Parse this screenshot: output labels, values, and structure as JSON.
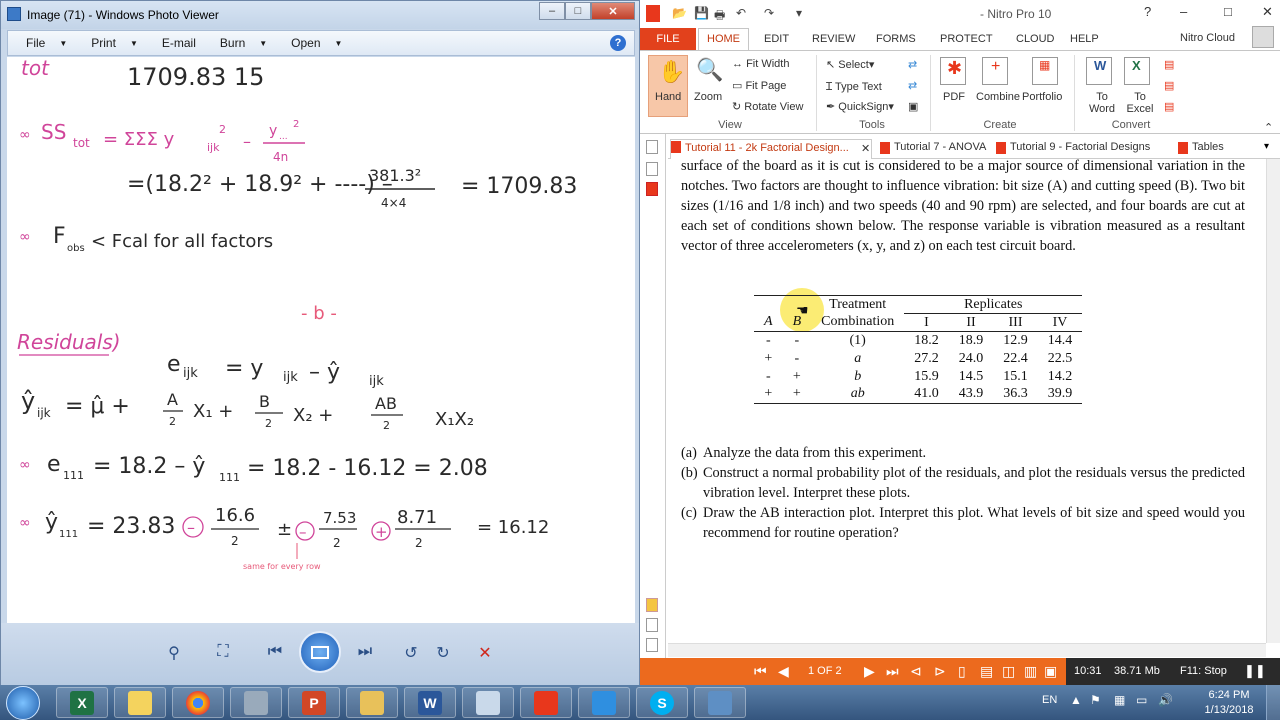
{
  "photo_viewer": {
    "title": "Image (71) - Windows Photo Viewer",
    "menu": [
      "File",
      "Print",
      "E-mail",
      "Burn",
      "Open"
    ],
    "help_label": "?",
    "notes": {
      "top_label": "tot",
      "line0": "1709.83    15",
      "line1_left": "SS",
      "line1_sub": "tot",
      "line1_expr": "= ΣΣΣ y",
      "line1_sub2": "ijk",
      "line1_exp": "2",
      "line1_minus": "–",
      "line1_frac_num": "y",
      "line1_frac_sub": "...",
      "line1_frac_exp": "2",
      "line1_frac_den": "4n",
      "line2": "=(18.2² + 18.9² + ----) –",
      "line2_frac_num": "381.3²",
      "line2_frac_den": "4×4",
      "line2_result": "=   1709.83",
      "line3": "F",
      "line3_sub": "obs",
      "line3_rest": "< Fcal    for all factors",
      "marker": "- b -",
      "residuals": "Residuals)",
      "eq1": "e",
      "eq1_sub": "ijk",
      "eq1_rest": "=  y",
      "eq1_sub2": "ijk",
      "eq1_rest2": "–  ŷ",
      "eq1_sub3": "ijk",
      "eq2": "ŷ",
      "eq2_sub": "ijk",
      "eq2_rest": "=  μ̂  +",
      "eq2_a": "A",
      "eq2_a_den": "2",
      "eq2_x1": "X₁  +",
      "eq2_b": "B",
      "eq2_b_den": "2",
      "eq2_x2": "X₂  +",
      "eq2_ab": "AB",
      "eq2_ab_den": "2",
      "eq2_x1x2": "X₁X₂",
      "eq3": "e",
      "eq3_sub": "111",
      "eq3_rest": "= 18.2 – ŷ",
      "eq3_sub2": "111",
      "eq3_rest2": "= 18.2 - 16.12   =   2.08",
      "eq4": "ŷ",
      "eq4_sub": "111",
      "eq4_rest": "= 23.83",
      "eq4_t1": "16.6",
      "eq4_t1_den": "2",
      "eq4_t2": "7.53",
      "eq4_t2_den": "2",
      "eq4_t3": "8.71",
      "eq4_t3_den": "2",
      "eq4_result": "=  16.12",
      "eq4_note": "same for every row"
    }
  },
  "nitro": {
    "title": "- Nitro Pro 10",
    "tabs": [
      "FILE",
      "HOME",
      "EDIT",
      "REVIEW",
      "FORMS",
      "PROTECT",
      "CLOUD",
      "HELP"
    ],
    "active_tab": "HOME",
    "user": "Nitro Cloud",
    "ribbon": {
      "hand": "Hand",
      "zoom": "Zoom",
      "fit_width": "Fit Width",
      "fit_page": "Fit Page",
      "rotate_view": "Rotate View",
      "select": "Select",
      "type_text": "Type Text",
      "quicksign": "QuickSign",
      "pdf": "PDF",
      "combine": "Combine",
      "portfolio": "Portfolio",
      "to_word": "To Word",
      "to_excel": "To Excel",
      "groups": [
        "View",
        "Tools",
        "Create",
        "Convert"
      ]
    },
    "doc_tabs": [
      "Tutorial 11 - 2k Factorial Design...",
      "Tutorial 7 - ANOVA",
      "Tutorial 9 - Factorial Designs",
      "Tables"
    ],
    "paragraph": "surface of the board as it is cut is considered to be a major source of dimensional variation in the notches. Two factors are thought to influence vibration: bit size (A) and cutting speed (B). Two bit sizes (1/16 and 1/8 inch) and two speeds (40 and 90 rpm) are selected, and four boards are cut at each set of conditions shown below. The response variable is vibration measured as a resultant vector of three accelerometers (x, y, and z) on each test circuit board.",
    "table": {
      "header_top": [
        "",
        "",
        "Treatment",
        "Replicates"
      ],
      "header": [
        "A",
        "B",
        "Combination",
        "I",
        "II",
        "III",
        "IV"
      ],
      "rows": [
        [
          "-",
          "-",
          "(1)",
          "18.2",
          "18.9",
          "12.9",
          "14.4"
        ],
        [
          "+",
          "-",
          "a",
          "27.2",
          "24.0",
          "22.4",
          "22.5"
        ],
        [
          "-",
          "+",
          "b",
          "15.9",
          "14.5",
          "15.1",
          "14.2"
        ],
        [
          "+",
          "+",
          "ab",
          "41.0",
          "43.9",
          "36.3",
          "39.9"
        ]
      ]
    },
    "questions": [
      {
        "label": "(a)",
        "text": "Analyze the data from this experiment."
      },
      {
        "label": "(b)",
        "text": "Construct a normal probability plot of the residuals, and plot the residuals versus the predicted vibration level. Interpret these plots."
      },
      {
        "label": "(c)",
        "text": "Draw the AB interaction plot. Interpret this plot. What levels of bit size and speed would you recommend for routine operation?"
      }
    ],
    "status": {
      "page": "1 OF 2",
      "time": "10:31",
      "memory": "38.71 Mb",
      "stop": "F11: Stop"
    }
  },
  "taskbar": {
    "lang": "EN",
    "time": "6:24 PM",
    "date": "1/13/2018",
    "apps": [
      "excel",
      "folder-notes",
      "chrome",
      "calculator",
      "powerpoint",
      "explorer",
      "word",
      "paint",
      "nitro",
      "snipping",
      "skype",
      "photo-viewer"
    ]
  }
}
